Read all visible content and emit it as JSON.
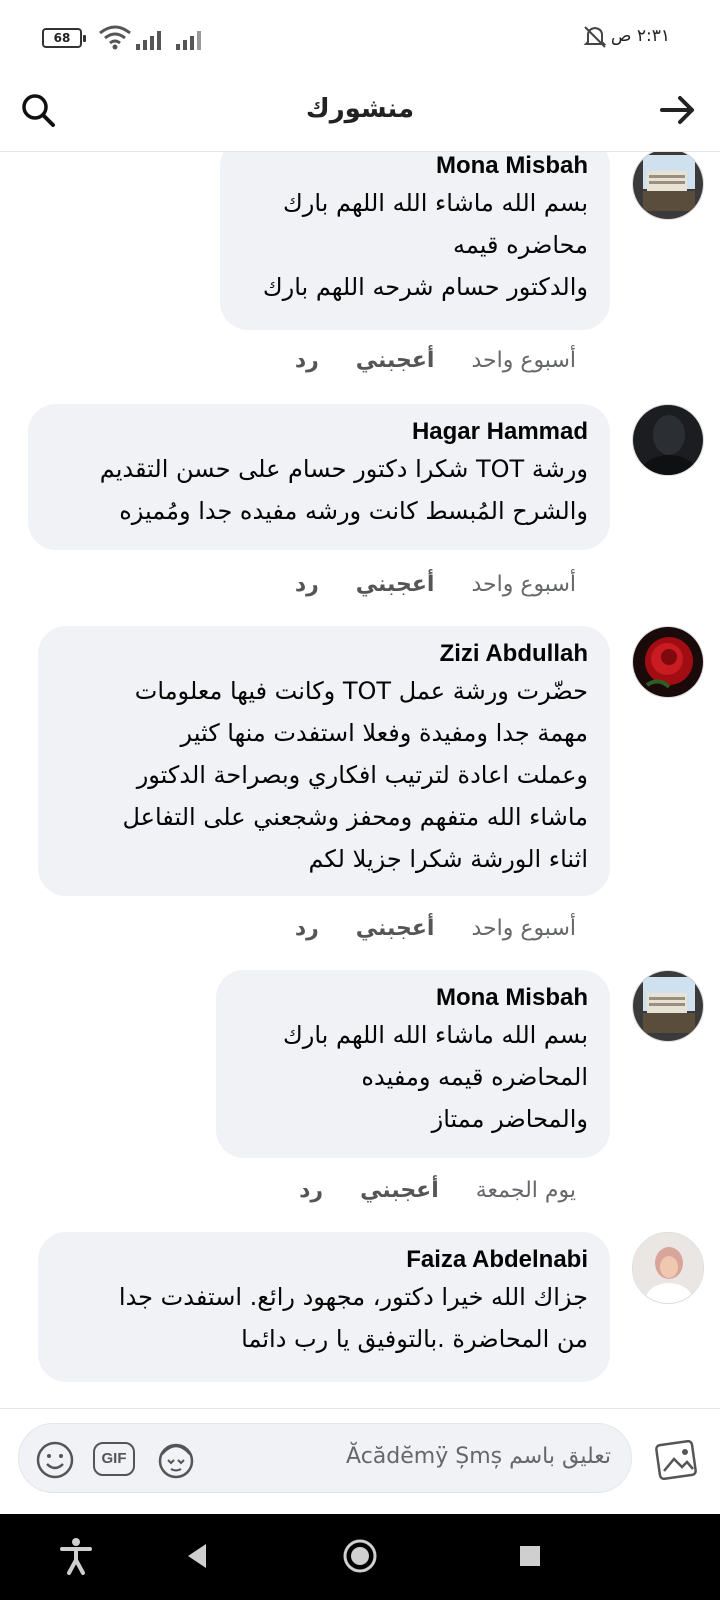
{
  "status": {
    "battery": "68",
    "time": "٢:٣١ ص"
  },
  "header": {
    "title": "منشورك"
  },
  "comments": [
    {
      "author": "Mona Misbah",
      "text": "بسم الله ماشاء الله اللهم بارك\nمحاضره قيمه\nوالدكتور حسام شرحه اللهم بارك",
      "time": "أسبوع واحد",
      "like": "أعجبني",
      "reply": "رد",
      "avatar": "building-photo"
    },
    {
      "author": "Hagar Hammad",
      "text": "ورشة TOT شكرا دكتور حسام على حسن التقديم\nوالشرح المُبسط كانت ورشه مفيده جدا ومُميزه",
      "time": "أسبوع واحد",
      "like": "أعجبني",
      "reply": "رد",
      "avatar": "dark-portrait"
    },
    {
      "author": "Zizi Abdullah",
      "text": "حضّرت ورشة عمل TOT وكانت فيها معلومات\nمهمة جدا ومفيدة وفعلا استفدت منها كثير\nوعملت اعادة لترتيب افكاري وبصراحة الدكتور\nماشاء الله متفهم ومحفز وشجعني على التفاعل\nاثناء الورشة        شكرا جزيلا لكم",
      "time": "أسبوع واحد",
      "like": "أعجبني",
      "reply": "رد",
      "avatar": "red-rose"
    },
    {
      "author": "Mona Misbah",
      "text": "بسم الله ماشاء الله اللهم بارك\nالمحاضره قيمه ومفيده\nوالمحاضر ممتاز",
      "time": "يوم الجمعة",
      "like": "أعجبني",
      "reply": "رد",
      "avatar": "building-photo"
    },
    {
      "author": "Faiza Abdelnabi",
      "text": "جزاك الله خيرا دكتور، مجهود رائع. استفدت جدا\nمن المحاضرة .بالتوفيق يا رب دائما",
      "time": "",
      "like": "",
      "reply": "",
      "avatar": "woman-portrait"
    }
  ],
  "composer": {
    "placeholder": "تعليق باسم Ăcădĕmÿ Șmș",
    "gif_label": "GIF"
  },
  "colors": {
    "bubble": "#f0f2f5",
    "secondary_text": "#65676b",
    "navbar": "#000000"
  }
}
